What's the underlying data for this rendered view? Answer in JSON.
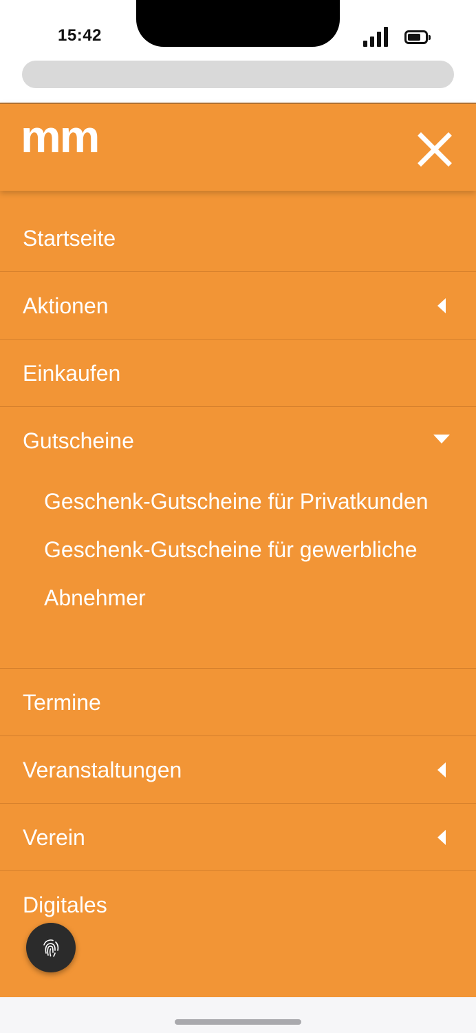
{
  "status_bar": {
    "time": "15:42",
    "signal_icon": "cellular-signal-icon",
    "battery_icon": "battery-icon",
    "battery_level": 0.75
  },
  "header": {
    "logo_text": "mm",
    "close_icon": "close-x-icon"
  },
  "nav": {
    "items": [
      {
        "label": "Startseite"
      },
      {
        "label": "Aktionen",
        "caret": "collapsed"
      },
      {
        "label": "Einkaufen"
      },
      {
        "label": "Gutscheine",
        "caret": "expanded",
        "subitems": [
          {
            "label": "Geschenk-Gutscheine für Privatkunden"
          },
          {
            "label": "Geschenk-Gutscheine für gewerbliche Abnehmer"
          }
        ]
      },
      {
        "label": "Termine"
      },
      {
        "label": "Veranstaltungen",
        "caret": "collapsed"
      },
      {
        "label": "Verein",
        "caret": "collapsed"
      },
      {
        "label": "Digitales"
      }
    ]
  },
  "fab": {
    "icon": "fingerprint-icon"
  },
  "colors": {
    "menu_bg": "#f29536",
    "divider": "#d47f2c",
    "text": "#ffffff",
    "fab_bg": "#2b2b2b"
  }
}
